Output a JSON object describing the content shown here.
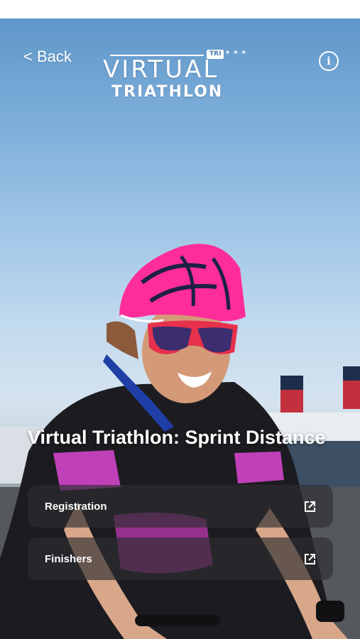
{
  "header": {
    "back_label": "< Back",
    "info_icon": "info-circle-icon"
  },
  "logo": {
    "badge": "TRI",
    "word1": "VIRTUAL",
    "word2": "TRIATHLON"
  },
  "event": {
    "title": "Virtual Triathlon: Sprint Distance"
  },
  "links": [
    {
      "label": "Registration",
      "icon": "external-link-icon"
    },
    {
      "label": "Finishers",
      "icon": "external-link-icon"
    }
  ],
  "colors": {
    "sky": "#a5c9e8",
    "card_background": "#2d2d30",
    "helmet": "#ff2d9a",
    "text": "#ffffff"
  }
}
